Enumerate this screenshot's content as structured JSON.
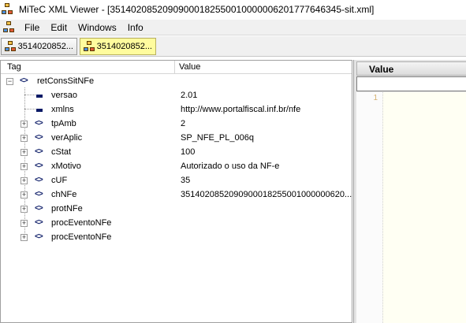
{
  "window": {
    "title": "MiTeC XML Viewer - [351402085209090001825500100000062017776463​45-sit.xml]"
  },
  "menu": {
    "items": [
      "File",
      "Edit",
      "Windows",
      "Info"
    ]
  },
  "tabs": [
    {
      "label": "3514020852...",
      "active": false
    },
    {
      "label": "3514020852...",
      "active": true
    }
  ],
  "tree": {
    "columns": {
      "tag": "Tag",
      "value": "Value"
    },
    "root": {
      "tag": "retConsSitNFe"
    },
    "children": [
      {
        "tag": "versao",
        "value": "2.01",
        "kind": "attribute"
      },
      {
        "tag": "xmlns",
        "value": "http://www.portalfiscal.inf.br/nfe",
        "kind": "attribute"
      },
      {
        "tag": "tpAmb",
        "value": "2",
        "kind": "element"
      },
      {
        "tag": "verAplic",
        "value": "SP_NFE_PL_006q",
        "kind": "element"
      },
      {
        "tag": "cStat",
        "value": "100",
        "kind": "element"
      },
      {
        "tag": "xMotivo",
        "value": "Autorizado o uso da NF-e",
        "kind": "element"
      },
      {
        "tag": "cUF",
        "value": "35",
        "kind": "element"
      },
      {
        "tag": "chNFe",
        "value": "3514020852090900018255001000000620...",
        "kind": "element"
      },
      {
        "tag": "protNFe",
        "value": "",
        "kind": "element"
      },
      {
        "tag": "procEventoNFe",
        "value": "",
        "kind": "element"
      },
      {
        "tag": "procEventoNFe",
        "value": "",
        "kind": "element"
      }
    ]
  },
  "value_panel": {
    "header": "Value",
    "line_number": "1"
  },
  "colors": {
    "active_tab": "#fffc9e",
    "tag_icon": "#0a1a66",
    "line_number": "#d4b070"
  }
}
